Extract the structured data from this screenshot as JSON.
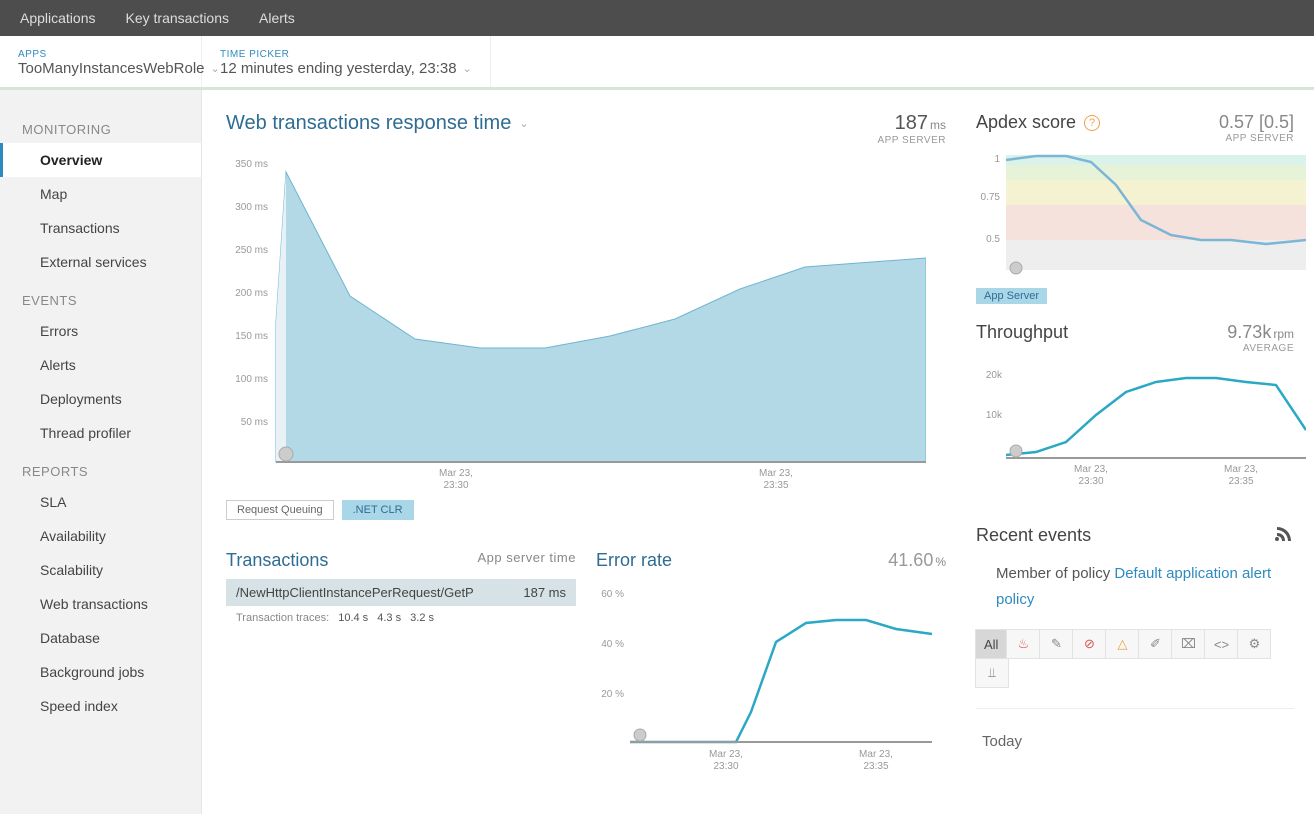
{
  "topnav": {
    "items": [
      "Applications",
      "Key transactions",
      "Alerts"
    ]
  },
  "subbar": {
    "apps_label": "APPS",
    "apps_value": "TooManyInstancesWebRole",
    "time_label": "TIME PICKER",
    "time_value": "12 minutes ending yesterday, 23:38"
  },
  "sidebar": {
    "sections": [
      {
        "label": "MONITORING",
        "items": [
          "Overview",
          "Map",
          "Transactions",
          "External services"
        ],
        "active_index": 0
      },
      {
        "label": "EVENTS",
        "items": [
          "Errors",
          "Alerts",
          "Deployments",
          "Thread profiler"
        ]
      },
      {
        "label": "REPORTS",
        "items": [
          "SLA",
          "Availability",
          "Scalability",
          "Web transactions",
          "Database",
          "Background jobs",
          "Speed index"
        ]
      }
    ]
  },
  "response_chart": {
    "title": "Web transactions response time",
    "value": "187",
    "unit": "ms",
    "sub": "APP SERVER",
    "legend": [
      {
        "label": "Request Queuing",
        "active": false
      },
      {
        "label": ".NET CLR",
        "active": true
      }
    ]
  },
  "apdex": {
    "title": "Apdex score",
    "value": "0.57 [0.5]",
    "sub": "APP SERVER",
    "legend": "App Server"
  },
  "throughput": {
    "title": "Throughput",
    "value": "9.73k",
    "unit": "rpm",
    "sub": "AVERAGE"
  },
  "transactions": {
    "title": "Transactions",
    "sub": "App server time",
    "row_name": "/NewHttpClientInstancePerRequest/GetP",
    "row_val": "187 ms",
    "traces_label": "Transaction traces:",
    "traces": [
      "10.4 s",
      "4.3 s",
      "3.2 s"
    ]
  },
  "error_rate": {
    "title": "Error rate",
    "value": "41.60",
    "unit": "%"
  },
  "events": {
    "title": "Recent events",
    "policy_prefix": "Member of policy ",
    "policy_link": "Default application alert policy",
    "filter_all": "All",
    "today": "Today"
  },
  "axis_ticks": {
    "main_y": [
      "350 ms",
      "300 ms",
      "250 ms",
      "200 ms",
      "150 ms",
      "100 ms",
      "50 ms"
    ],
    "main_x": [
      "Mar 23,",
      "23:30",
      "Mar 23,",
      "23:35"
    ],
    "apdex_y": [
      "1",
      "0.75",
      "0.5"
    ],
    "thr_y": [
      "20k",
      "10k"
    ],
    "thr_x": [
      "Mar 23,",
      "23:30",
      "Mar 23,",
      "23:35"
    ],
    "err_y": [
      "60 %",
      "40 %",
      "20 %"
    ],
    "err_x": [
      "Mar 23,",
      "23:30",
      "Mar 23,",
      "23:35"
    ]
  },
  "chart_data": [
    {
      "type": "area",
      "title": "Web transactions response time",
      "series_name": ".NET CLR",
      "x": [
        "23:28",
        "23:29",
        "23:30",
        "23:31",
        "23:32",
        "23:33",
        "23:34",
        "23:35",
        "23:36",
        "23:37",
        "23:38"
      ],
      "values": [
        170,
        340,
        200,
        150,
        140,
        140,
        155,
        175,
        210,
        235,
        245
      ],
      "ylabel": "ms",
      "ylim": [
        0,
        350
      ],
      "xlabel": "Mar 23"
    },
    {
      "type": "line",
      "title": "Apdex score (App Server)",
      "x": [
        "23:28",
        "23:29",
        "23:30",
        "23:31",
        "23:32",
        "23:33",
        "23:34",
        "23:35",
        "23:36",
        "23:37",
        "23:38"
      ],
      "values": [
        0.97,
        1.0,
        1.0,
        0.95,
        0.8,
        0.6,
        0.52,
        0.5,
        0.5,
        0.48,
        0.5
      ],
      "ylim": [
        0,
        1
      ],
      "bands": [
        [
          0.94,
          1.0,
          "#d9f2ea"
        ],
        [
          0.85,
          0.94,
          "#e7f3d9"
        ],
        [
          0.7,
          0.85,
          "#f5f2d2"
        ],
        [
          0.5,
          0.7,
          "#f6e2dd"
        ],
        [
          0.0,
          0.5,
          "#eeeeee"
        ]
      ]
    },
    {
      "type": "line",
      "title": "Throughput",
      "x": [
        "23:28",
        "23:29",
        "23:30",
        "23:31",
        "23:32",
        "23:33",
        "23:34",
        "23:35",
        "23:36",
        "23:37",
        "23:38"
      ],
      "values": [
        500,
        1000,
        3000,
        7000,
        12000,
        15000,
        16500,
        16500,
        16000,
        15500,
        6000
      ],
      "ylabel": "rpm",
      "ylim": [
        0,
        20000
      ]
    },
    {
      "type": "line",
      "title": "Error rate",
      "x": [
        "23:28",
        "23:29",
        "23:30",
        "23:31",
        "23:32",
        "23:33",
        "23:34",
        "23:35",
        "23:36",
        "23:37",
        "23:38"
      ],
      "values": [
        0,
        0,
        0,
        0,
        12,
        42,
        49,
        50,
        50,
        47,
        45
      ],
      "ylabel": "%",
      "ylim": [
        0,
        60
      ]
    }
  ]
}
